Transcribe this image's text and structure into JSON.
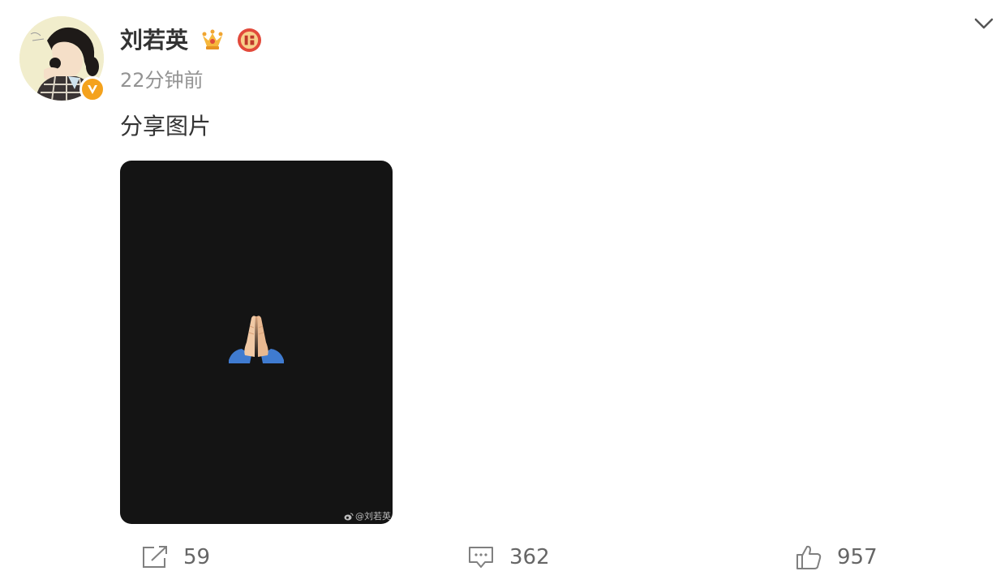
{
  "post": {
    "author": {
      "name": "刘若英",
      "avatar_icon": "avatar-illustration",
      "badges": [
        "crown-icon",
        "fu-badge-icon",
        "vip-v-icon"
      ]
    },
    "timestamp": "22分钟前",
    "text": "分享图片",
    "image": {
      "content_icon": "folded-hands-emoji",
      "background": "#141414",
      "watermark": "@刘若英"
    },
    "actions": {
      "repost_count": "59",
      "comment_count": "362",
      "like_count": "957"
    }
  },
  "colors": {
    "text_primary": "#333333",
    "text_secondary": "#939393",
    "icon_gray": "#808080",
    "vip_orange": "#f4a21d"
  }
}
